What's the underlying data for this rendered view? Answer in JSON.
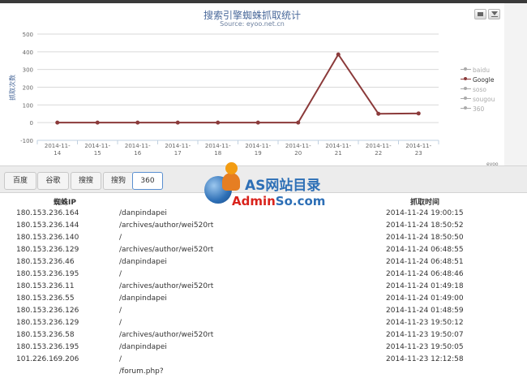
{
  "chart": {
    "title": "搜索引擎蜘蛛抓取统计",
    "subtitle": "Source: eyoo.net.cn",
    "credit": "eyoo",
    "print_icon": "printer-icon",
    "export_icon": "download-icon"
  },
  "chart_data": {
    "type": "line",
    "title": "搜索引擎蜘蛛抓取统计",
    "subtitle": "Source: eyoo.net.cn",
    "xlabel": "",
    "ylabel": "抓取次数",
    "categories": [
      "2014-11-14",
      "2014-11-15",
      "2014-11-16",
      "2014-11-17",
      "2014-11-18",
      "2014-11-19",
      "2014-11-20",
      "2014-11-21",
      "2014-11-22",
      "2014-11-23"
    ],
    "x_ticks": [
      [
        "2014-11-",
        "14"
      ],
      [
        "2014-11-",
        "15"
      ],
      [
        "2014-11-",
        "16"
      ],
      [
        "2014-11-",
        "17"
      ],
      [
        "2014-11-",
        "18"
      ],
      [
        "2014-11-",
        "19"
      ],
      [
        "2014-11-",
        "20"
      ],
      [
        "2014-11-",
        "21"
      ],
      [
        "2014-11-",
        "22"
      ],
      [
        "2014-11-",
        "23"
      ]
    ],
    "ylim": [
      -100,
      500
    ],
    "yticks": [
      -100,
      0,
      100,
      200,
      300,
      400,
      500
    ],
    "grid": true,
    "legend_position": "right",
    "series": [
      {
        "name": "Google",
        "color": "#8b3a3a",
        "values": [
          0,
          0,
          0,
          0,
          0,
          0,
          0,
          385,
          50,
          52
        ]
      }
    ],
    "legend": [
      {
        "name": "baidu",
        "active": false
      },
      {
        "name": "Google",
        "active": true
      },
      {
        "name": "soso",
        "active": false
      },
      {
        "name": "sougou",
        "active": false
      },
      {
        "name": "360",
        "active": false
      }
    ]
  },
  "tabs": [
    {
      "label": "百度",
      "active": false
    },
    {
      "label": "谷歌",
      "active": false
    },
    {
      "label": "搜搜",
      "active": false
    },
    {
      "label": "搜狗",
      "active": false
    },
    {
      "label": "360",
      "active": true
    }
  ],
  "table": {
    "headers": {
      "ip": "蜘蛛IP",
      "time": "抓取时间"
    },
    "rows": [
      {
        "ip": "180.153.236.164",
        "path": "/danpindapei",
        "time": "2014-11-24 19:00:15"
      },
      {
        "ip": "180.153.236.144",
        "path": "/archives/author/wei520rt",
        "time": "2014-11-24 18:50:52"
      },
      {
        "ip": "180.153.236.140",
        "path": "/",
        "time": "2014-11-24 18:50:50"
      },
      {
        "ip": "180.153.236.129",
        "path": "/archives/author/wei520rt",
        "time": "2014-11-24 06:48:55"
      },
      {
        "ip": "180.153.236.46",
        "path": "/danpindapei",
        "time": "2014-11-24 06:48:51"
      },
      {
        "ip": "180.153.236.195",
        "path": "/",
        "time": "2014-11-24 06:48:46"
      },
      {
        "ip": "180.153.236.11",
        "path": "/archives/author/wei520rt",
        "time": "2014-11-24 01:49:18"
      },
      {
        "ip": "180.153.236.55",
        "path": "/danpindapei",
        "time": "2014-11-24 01:49:00"
      },
      {
        "ip": "180.153.236.126",
        "path": "/",
        "time": "2014-11-24 01:48:59"
      },
      {
        "ip": "180.153.236.129",
        "path": "/",
        "time": "2014-11-23 19:50:12"
      },
      {
        "ip": "180.153.236.58",
        "path": "/archives/author/wei520rt",
        "time": "2014-11-23 19:50:07"
      },
      {
        "ip": "180.153.236.195",
        "path": "/danpindapei",
        "time": "2014-11-23 19:50:05"
      },
      {
        "ip": "101.226.169.206",
        "path": "/",
        "time": "2014-11-23 12:12:58"
      },
      {
        "ip": "",
        "path": "/forum.php?",
        "time": ""
      }
    ]
  },
  "watermark": {
    "line1": "AS网站目录",
    "line2_red": "Admin",
    "line2_blue": "So.com"
  }
}
